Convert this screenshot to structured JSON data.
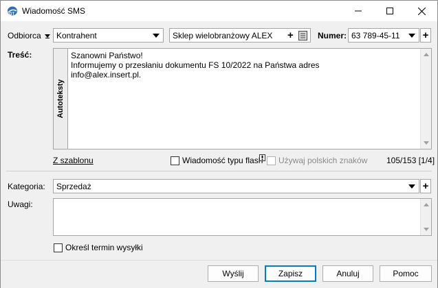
{
  "window": {
    "title": "Wiadomość SMS"
  },
  "header": {
    "recipient_type_label": "Odbiorca",
    "recipient_kind": "Kontrahent",
    "recipient_name": "Sklep wielobranżowy  ALEX",
    "number_label": "Numer:",
    "number_value": "63 789-45-11"
  },
  "content": {
    "label": "Treść:",
    "autotexts_label": "Autoteksty",
    "lines": [
      "Szanowni Państwo!",
      "Informujemy o przesłaniu dokumentu FS 10/2022 na Państwa adres",
      "info@alex.insert.pl."
    ],
    "from_template_link": "Z szablonu",
    "flash_label": "Wiadomość typu flash",
    "flash_info_icon": "exclamation-info-icon",
    "polish_chars_label": "Używaj polskich znaków",
    "char_counter": "105/153 [1/4]"
  },
  "category": {
    "label": "Kategoria:",
    "value": "Sprzedaż"
  },
  "notes": {
    "label": "Uwagi:",
    "value": ""
  },
  "schedule": {
    "label": "Określ termin wysyłki"
  },
  "buttons": {
    "send": "Wyślij",
    "save": "Zapisz",
    "cancel": "Anuluj",
    "help": "Pomoc"
  },
  "colors": {
    "accent": "#0078d7",
    "disabled_text": "#8a8a8a"
  }
}
